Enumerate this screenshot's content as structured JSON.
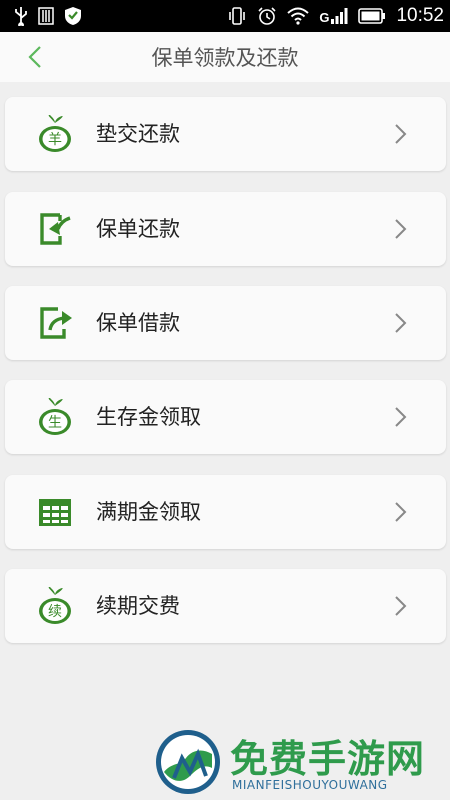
{
  "status_bar": {
    "time": "10:52",
    "network": "G"
  },
  "header": {
    "title": "保单领款及还款",
    "back_icon": "chevron-left-icon"
  },
  "menu": {
    "items": [
      {
        "label": "垫交还款",
        "icon": "money-bag-yen-icon",
        "icon_text": "羊"
      },
      {
        "label": "保单还款",
        "icon": "return-arrow-icon"
      },
      {
        "label": "保单借款",
        "icon": "share-arrow-icon"
      },
      {
        "label": "生存金领取",
        "icon": "money-bag-survival-icon",
        "icon_text": "生"
      },
      {
        "label": "满期金领取",
        "icon": "table-calendar-icon"
      },
      {
        "label": "续期交费",
        "icon": "money-bag-renewal-icon",
        "icon_text": "续"
      }
    ]
  },
  "watermark": {
    "title": "免费手游网",
    "subtitle": "MIANFEISHOUYOUWANG"
  },
  "colors": {
    "accent": "#3a8a2a",
    "back": "#5cb85c",
    "background": "#efefef",
    "card": "#fafafa"
  }
}
